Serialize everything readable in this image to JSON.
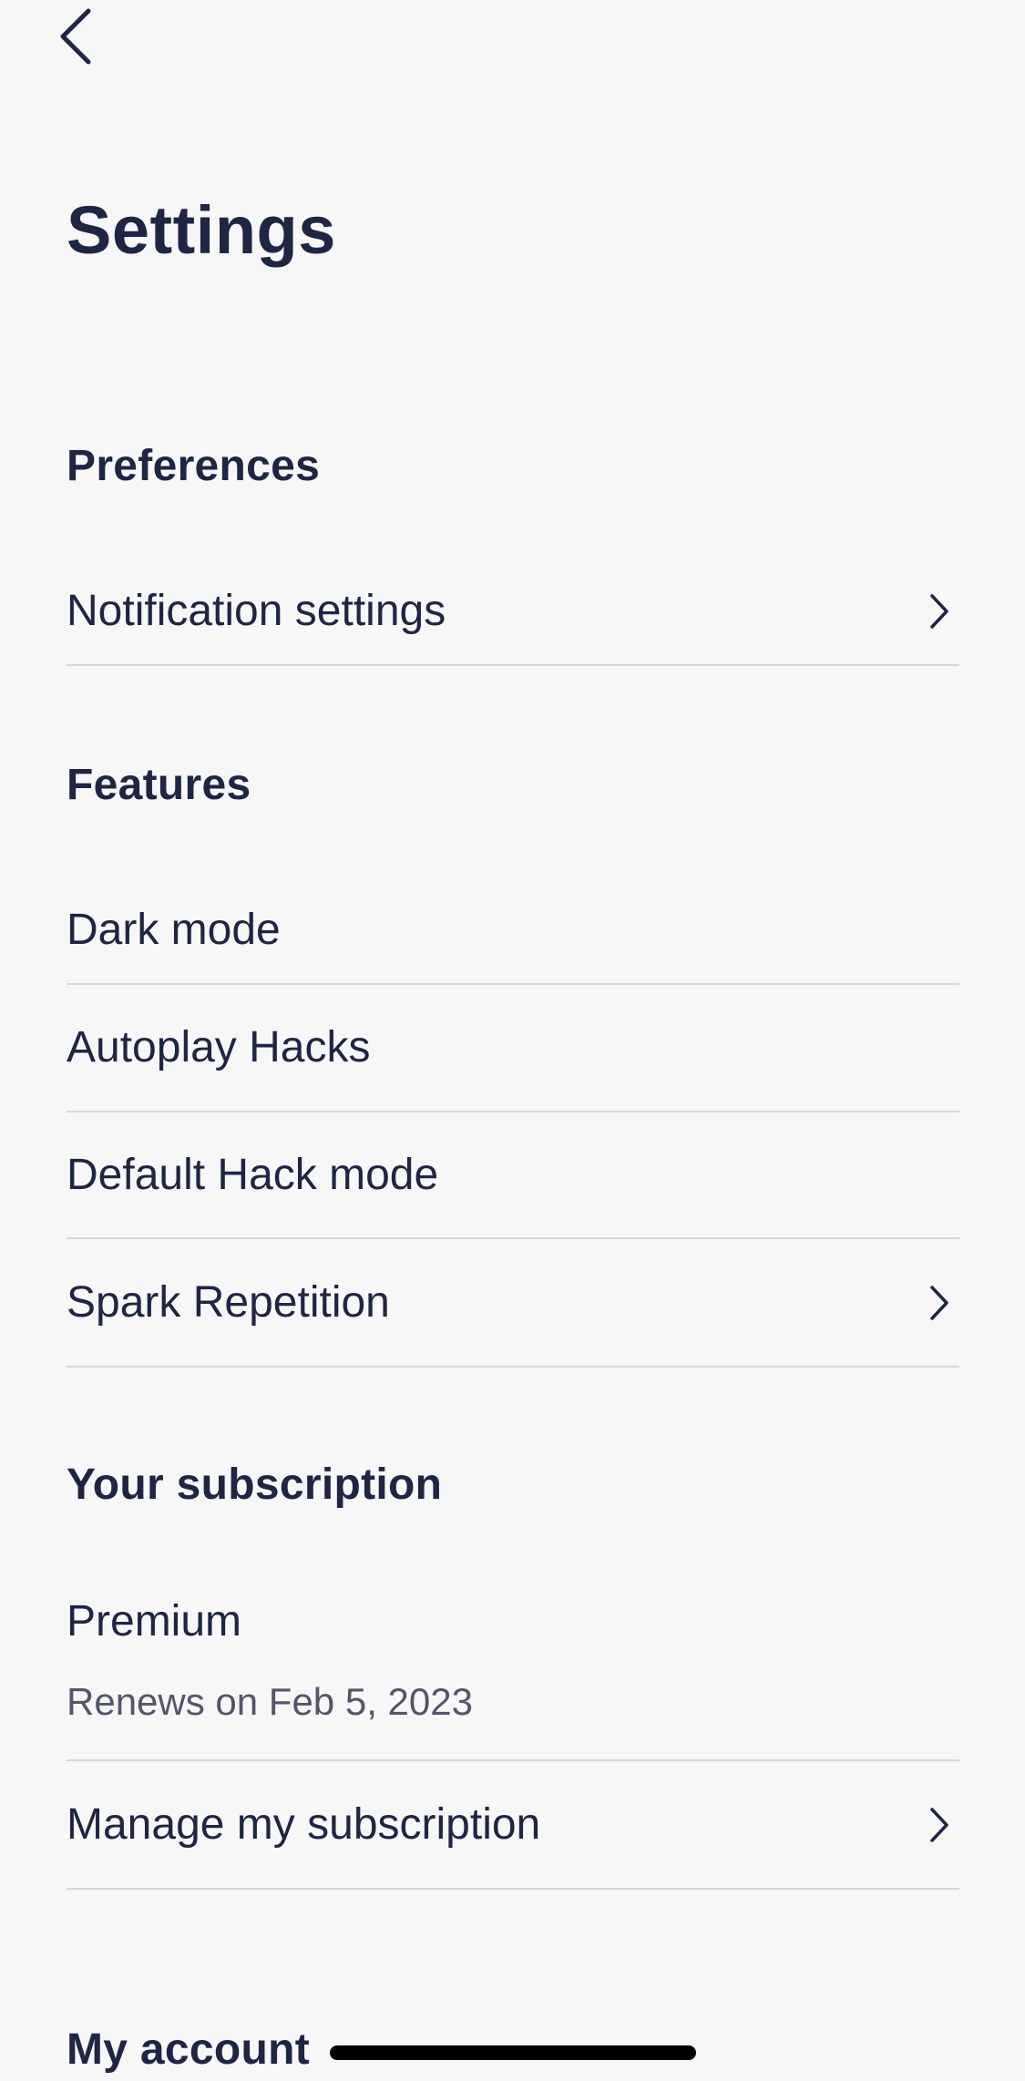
{
  "header": {
    "title": "Settings",
    "back_icon": "chevron-left-icon"
  },
  "sections": {
    "preferences": {
      "title": "Preferences",
      "items": [
        {
          "label": "Notification settings",
          "has_chevron": true
        }
      ]
    },
    "features": {
      "title": "Features",
      "items": [
        {
          "label": "Dark mode",
          "has_chevron": false
        },
        {
          "label": "Autoplay Hacks",
          "has_chevron": false
        },
        {
          "label": "Default Hack mode",
          "has_chevron": false
        },
        {
          "label": "Spark Repetition",
          "has_chevron": true
        }
      ]
    },
    "subscription": {
      "title": "Your subscription",
      "plan": "Premium",
      "renewal": "Renews on Feb 5, 2023",
      "manage_label": "Manage my subscription"
    },
    "account": {
      "title": "My account"
    }
  },
  "colors": {
    "background": "#f7f7f8",
    "text_primary": "#1f2544",
    "text_secondary": "#53566a",
    "divider": "#d6d7dc"
  }
}
